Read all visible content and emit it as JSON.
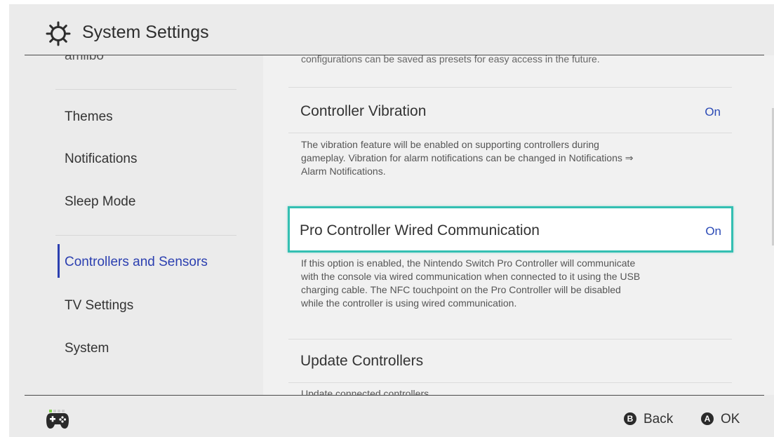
{
  "header": {
    "title": "System Settings",
    "icon": "gear-icon"
  },
  "sidebar": {
    "cut_item": "amiibo",
    "items": [
      {
        "label": "Themes",
        "active": false
      },
      {
        "label": "Notifications",
        "active": false
      },
      {
        "label": "Sleep Mode",
        "active": false
      },
      {
        "label": "Controllers and Sensors",
        "active": true
      },
      {
        "label": "TV Settings",
        "active": false
      },
      {
        "label": "System",
        "active": false
      }
    ]
  },
  "content": {
    "top_desc": "configurations can be saved as presets for easy access in the future.",
    "settings": [
      {
        "label": "Controller Vibration",
        "value": "On",
        "description_lines": [
          "The vibration feature will be enabled on supporting controllers during",
          "gameplay. Vibration for alarm notifications can be changed in Notifications ⇒",
          "Alarm Notifications."
        ]
      },
      {
        "label": "Pro Controller Wired Communication",
        "value": "On",
        "selected": true,
        "description_lines": [
          "If this option is enabled, the Nintendo Switch Pro Controller will communicate",
          "with the console via wired communication when connected to it using the USB",
          "charging cable. The NFC touchpoint on the Pro Controller will be disabled",
          "while the controller is using wired communication."
        ]
      },
      {
        "label": "Update Controllers",
        "value": "",
        "description_lines": [
          "Update connected controllers."
        ]
      }
    ]
  },
  "footer": {
    "controller_icon": "gamepad-icon",
    "back": {
      "glyph": "B",
      "label": "Back"
    },
    "ok": {
      "glyph": "A",
      "label": "OK"
    }
  },
  "colors": {
    "accent_blue": "#2b3fb0",
    "selection_teal": "#34bfb2",
    "background": "#ebebeb"
  }
}
